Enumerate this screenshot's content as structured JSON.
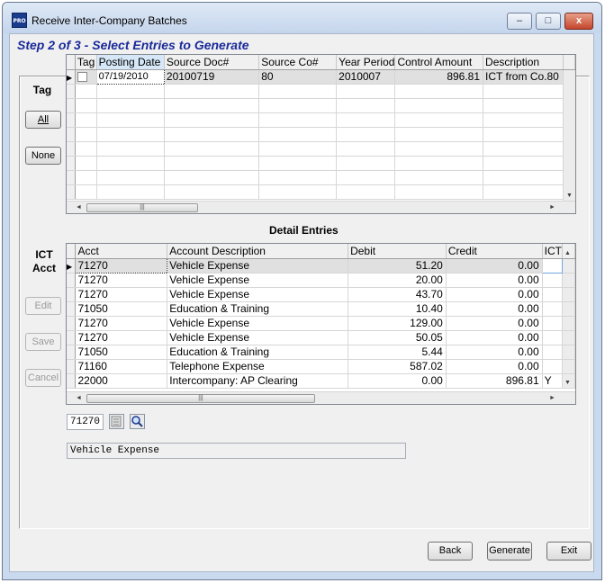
{
  "window": {
    "title": "Receive Inter-Company Batches",
    "icon_text": "PRO",
    "minimize_label": "–",
    "maximize_label": "□",
    "close_label": "x"
  },
  "step_title": "Step 2 of 3 - Select Entries to Generate",
  "tag_panel": {
    "label": "Tag",
    "all_label": "All",
    "none_label": "None"
  },
  "batch_grid": {
    "columns": [
      "Tag",
      "Posting Date",
      "Source Doc#",
      "Source Co#",
      "Year Period",
      "Control Amount",
      "Description"
    ],
    "rows": [
      {
        "tag": "",
        "posting_date": "07/19/2010",
        "source_doc": "20100719",
        "source_co": "80",
        "year_period": "2010007",
        "control_amount": "896.81",
        "description": "ICT from Co.80"
      }
    ]
  },
  "detail": {
    "heading": "Detail Entries",
    "side_label_1": "ICT",
    "side_label_2": "Acct",
    "edit_label": "Edit",
    "save_label": "Save",
    "cancel_label": "Cancel",
    "columns": [
      "Acct",
      "Account Description",
      "Debit",
      "Credit",
      "ICT"
    ],
    "rows": [
      {
        "acct": "71270",
        "desc": "Vehicle Expense",
        "debit": "51.20",
        "credit": "0.00",
        "ict": ""
      },
      {
        "acct": "71270",
        "desc": "Vehicle Expense",
        "debit": "20.00",
        "credit": "0.00",
        "ict": ""
      },
      {
        "acct": "71270",
        "desc": "Vehicle Expense",
        "debit": "43.70",
        "credit": "0.00",
        "ict": ""
      },
      {
        "acct": "71050",
        "desc": "Education & Training",
        "debit": "10.40",
        "credit": "0.00",
        "ict": ""
      },
      {
        "acct": "71270",
        "desc": "Vehicle Expense",
        "debit": "129.00",
        "credit": "0.00",
        "ict": ""
      },
      {
        "acct": "71270",
        "desc": "Vehicle Expense",
        "debit": "50.05",
        "credit": "0.00",
        "ict": ""
      },
      {
        "acct": "71050",
        "desc": "Education & Training",
        "debit": "5.44",
        "credit": "0.00",
        "ict": ""
      },
      {
        "acct": "71160",
        "desc": "Telephone Expense",
        "debit": "587.02",
        "credit": "0.00",
        "ict": ""
      },
      {
        "acct": "22000",
        "desc": "Intercompany: AP Clearing",
        "debit": "0.00",
        "credit": "896.81",
        "ict": "Y"
      }
    ],
    "account_field": "71270",
    "account_description": "Vehicle Expense",
    "icons": {
      "lookup": "list-icon",
      "zoom": "magnifier-icon"
    }
  },
  "footer": {
    "back_label": "Back",
    "generate_label": "Generate",
    "exit_label": "Exit"
  }
}
